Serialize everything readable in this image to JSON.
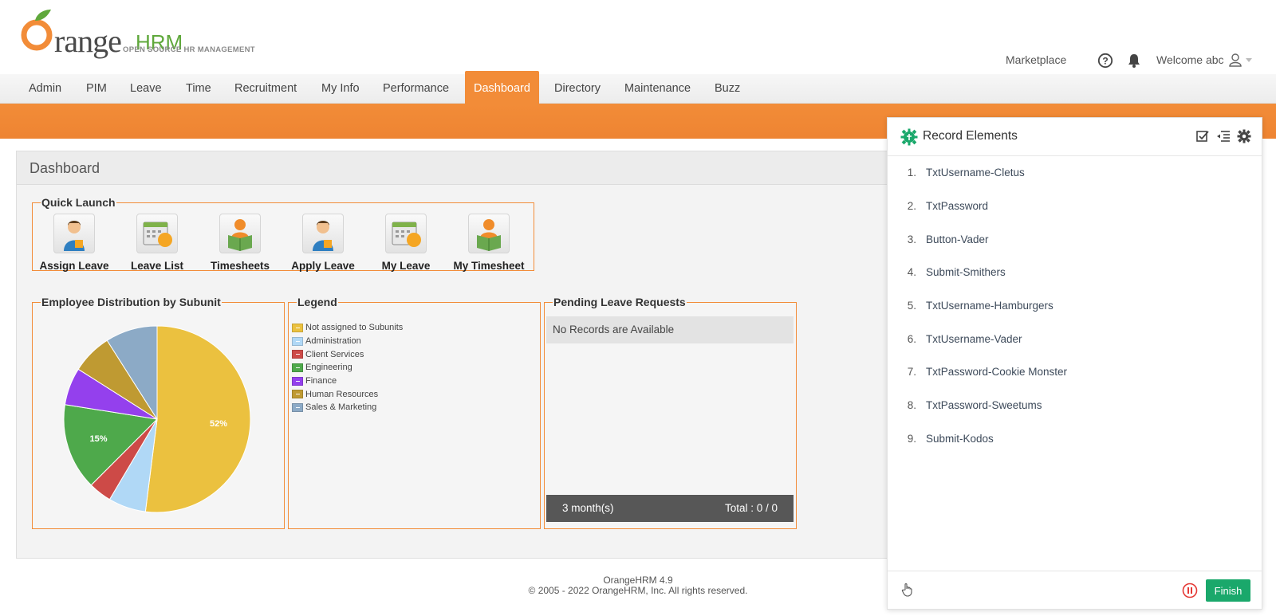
{
  "logo": {
    "text": "range",
    "hrm": "HRM",
    "tagline": "OPEN SOURCE HR MANAGEMENT"
  },
  "topbar": {
    "marketplace": "Marketplace",
    "welcome": "Welcome abc"
  },
  "menu": [
    "Admin",
    "PIM",
    "Leave",
    "Time",
    "Recruitment",
    "My Info",
    "Performance",
    "Dashboard",
    "Directory",
    "Maintenance",
    "Buzz"
  ],
  "page_title": "Dashboard",
  "quick_launch": {
    "title": "Quick Launch",
    "items": [
      {
        "label": "Assign Leave",
        "icon": "assign-leave-icon"
      },
      {
        "label": "Leave List",
        "icon": "leave-list-icon"
      },
      {
        "label": "Timesheets",
        "icon": "timesheets-icon"
      },
      {
        "label": "Apply Leave",
        "icon": "apply-leave-icon"
      },
      {
        "label": "My Leave",
        "icon": "my-leave-icon"
      },
      {
        "label": "My Timesheet",
        "icon": "my-timesheet-icon"
      }
    ]
  },
  "distribution": {
    "title": "Employee Distribution by Subunit"
  },
  "legend": {
    "title": "Legend",
    "items": [
      {
        "label": "Not assigned to Subunits",
        "color": "#ebc13f"
      },
      {
        "label": "Administration",
        "color": "#b0d8f6"
      },
      {
        "label": "Client Services",
        "color": "#cd4a47"
      },
      {
        "label": "Engineering",
        "color": "#4ea94b"
      },
      {
        "label": "Finance",
        "color": "#9440ed"
      },
      {
        "label": "Human Resources",
        "color": "#bf9a32"
      },
      {
        "label": "Sales & Marketing",
        "color": "#8caac6"
      }
    ]
  },
  "chart_data": {
    "type": "pie",
    "categories": [
      "Not assigned to Subunits",
      "Administration",
      "Client Services",
      "Engineering",
      "Finance",
      "Human Resources",
      "Sales & Marketing"
    ],
    "values": [
      52,
      6.5,
      4,
      15,
      6.5,
      7,
      9
    ],
    "colors": [
      "#ebc13f",
      "#b0d8f6",
      "#cd4a47",
      "#4ea94b",
      "#9440ed",
      "#bf9a32",
      "#8caac6"
    ],
    "data_labels": [
      "52%",
      "",
      "",
      "15%",
      "",
      "",
      ""
    ]
  },
  "pending": {
    "title": "Pending Leave Requests",
    "empty": "No Records are Available",
    "period": "3 month(s)",
    "total": "Total : 0 / 0"
  },
  "footer": {
    "version": "OrangeHRM 4.9",
    "copyright": "© 2005 - 2022 OrangeHRM, Inc. All rights reserved."
  },
  "recorder": {
    "title": "Record Elements",
    "items": [
      {
        "num": "1.",
        "label": "TxtUsername-Cletus"
      },
      {
        "num": "2.",
        "label": "TxtPassword"
      },
      {
        "num": "3.",
        "label": "Button-Vader"
      },
      {
        "num": "4.",
        "label": "Submit-Smithers"
      },
      {
        "num": "5.",
        "label": "TxtUsername-Hamburgers"
      },
      {
        "num": "6.",
        "label": "TxtUsername-Vader"
      },
      {
        "num": "7.",
        "label": "TxtPassword-Cookie Monster"
      },
      {
        "num": "8.",
        "label": "TxtPassword-Sweetums"
      },
      {
        "num": "9.",
        "label": "Submit-Kodos"
      }
    ],
    "finish": "Finish"
  }
}
